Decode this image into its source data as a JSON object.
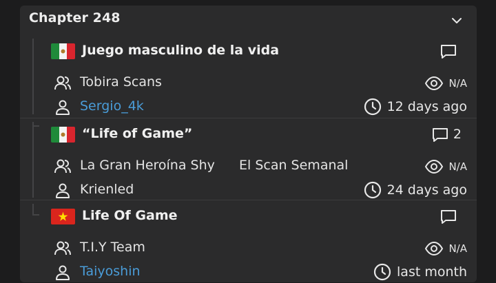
{
  "chapter": {
    "title": "Chapter 248"
  },
  "releases": [
    {
      "flag": "mexico",
      "title": "Juego masculino de la vida",
      "comment_count": "",
      "groups": [
        "Tobira Scans"
      ],
      "views": "N/A",
      "uploader": "Sergio_4k",
      "uploader_link": true,
      "time": "12 days ago"
    },
    {
      "flag": "mexico",
      "title": "“Life of Game”",
      "comment_count": "2",
      "groups": [
        "La Gran Heroína Shy",
        "El Scan Semanal"
      ],
      "views": "N/A",
      "uploader": "Krienled",
      "uploader_link": false,
      "time": "24 days ago"
    },
    {
      "flag": "vietnam",
      "title": "Life Of Game",
      "comment_count": "",
      "groups": [
        "T.I.Y Team"
      ],
      "views": "N/A",
      "uploader": "Taiyoshin",
      "uploader_link": true,
      "time": "last month"
    }
  ],
  "colors": {
    "background": "#1c1c1d",
    "card": "#2b2b2c",
    "link": "#4a9cd8",
    "text": "#e8e8e8"
  },
  "icons": [
    "chevron-down-icon",
    "comment-icon",
    "group-icon",
    "user-icon",
    "eye-icon",
    "clock-icon",
    "mexico-flag-icon",
    "vietnam-flag-icon"
  ]
}
